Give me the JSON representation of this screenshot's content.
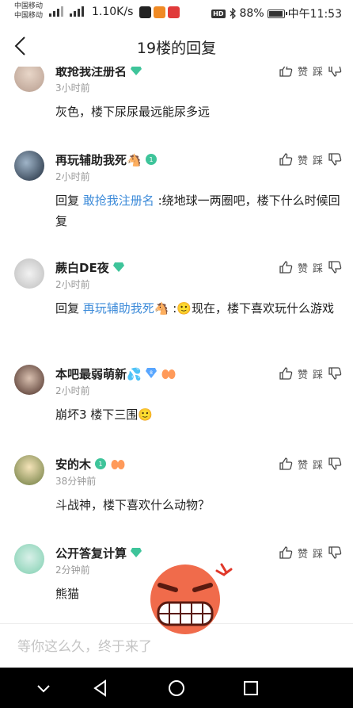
{
  "status": {
    "carrier1": "中国移动",
    "carrier2": "中国移动",
    "net_speed": "1.10K/s",
    "battery": "88%",
    "battery_level": 0.88,
    "time": "中午11:53",
    "hd": "HD"
  },
  "nav": {
    "title": "19楼的回复"
  },
  "replies": [
    {
      "name": "敢抢我注册名",
      "time": "3小时前",
      "text": "灰色，楼下尿尿最远能尿多远",
      "mention": "",
      "prefix": "",
      "like": "赞",
      "dislike": "踩"
    },
    {
      "name": "再玩辅助我死🐴",
      "time": "2小时前",
      "prefix": "回复 ",
      "mention": "敢抢我注册名",
      "text": " :绕地球一两圈吧，楼下什么时候回复",
      "like": "赞",
      "dislike": "踩"
    },
    {
      "name": "蕨白DE夜",
      "time": "2小时前",
      "prefix": "回复 ",
      "mention": "再玩辅助我死🐴",
      "text": " :🙂现在，楼下喜欢玩什么游戏",
      "like": "赞",
      "dislike": "踩"
    },
    {
      "name": "本吧最弱萌新💦",
      "time": "2小时前",
      "prefix": "",
      "mention": "",
      "text": "崩坏3 楼下三围🙂",
      "like": "赞",
      "dislike": "踩"
    },
    {
      "name": "安的木",
      "time": "38分钟前",
      "prefix": "",
      "mention": "",
      "text": "斗战神，楼下喜欢什么动物？",
      "like": "赞",
      "dislike": "踩"
    },
    {
      "name": "公开答复计算",
      "time": "2分钟前",
      "prefix": "",
      "mention": "",
      "text": "熊猫",
      "like": "赞",
      "dislike": "踩"
    }
  ],
  "input": {
    "placeholder": "等你这么久，终于来了"
  },
  "colors": {
    "mention": "#3d8bd9",
    "badge_green": "#3ec49a",
    "badge_blue": "#58a6ff"
  },
  "icons": [
    "back-arrow-icon",
    "thumb-up-icon",
    "thumb-down-icon",
    "diamond-badge-icon",
    "level-badge-icon",
    "nav-back-icon",
    "nav-home-icon",
    "nav-recent-icon",
    "angry-emoji-icon"
  ]
}
